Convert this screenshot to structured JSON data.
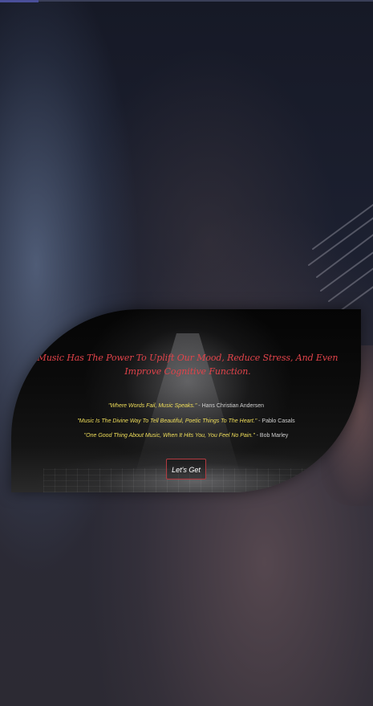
{
  "hero": {
    "headline": "Music Has The Power To Uplift Our Mood, Reduce Stress, And Even Improve Cognitive Function.",
    "quotes": [
      {
        "text": "\"Where Words Fail, Music Speaks.\"",
        "author": " - Hans Christian Andersen"
      },
      {
        "text": "\"Music Is The Divine Way To Tell Beautiful, Poetic Things To The Heart.\"",
        "author": " - Pablo Casals"
      },
      {
        "text": "\"One Good Thing About Music, When It Hits You, You Feel No Pain.\"",
        "author": " - Bob Marley"
      }
    ],
    "cta_label": "Let's Get"
  },
  "colors": {
    "headline": "#e2434a",
    "quote_text": "#f1df5a",
    "quote_author": "#d0d0d0",
    "cta_border": "#b23a40"
  }
}
